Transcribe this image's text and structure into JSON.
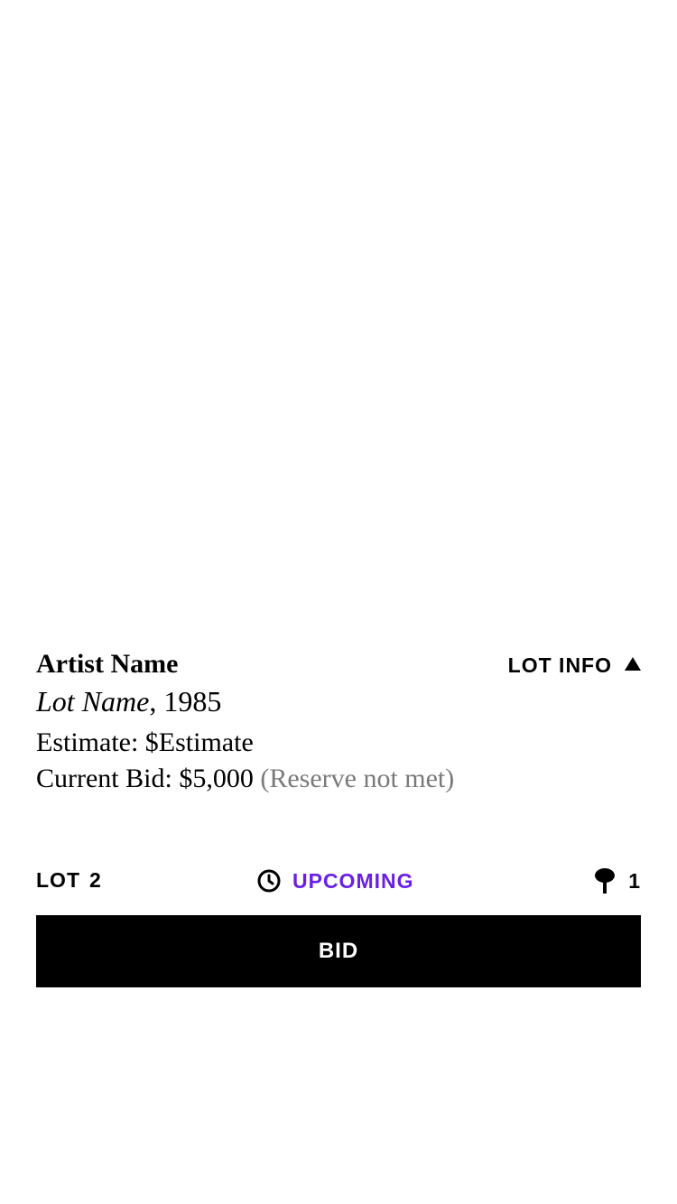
{
  "lot": {
    "artist_name": "Artist Name",
    "lot_name": "Lot Name",
    "year_suffix": ", 1985",
    "estimate": "Estimate: $Estimate",
    "current_bid": "Current Bid: $5,000",
    "reserve_status": "(Reserve not met)"
  },
  "lot_info": {
    "label": "LOT INFO",
    "icon": "triangle-up-icon"
  },
  "status_row": {
    "lot_label": "LOT",
    "lot_number": "2",
    "status_label": "UPCOMING",
    "status_icon": "clock-icon",
    "status_color": "#6a1fe6",
    "bid_count": "1",
    "bid_icon": "paddle-icon"
  },
  "actions": {
    "bid_label": "BID"
  }
}
